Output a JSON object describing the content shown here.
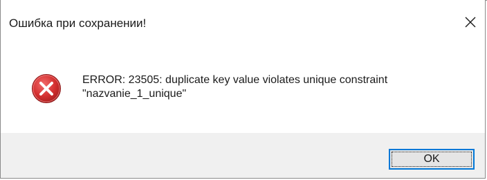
{
  "dialog": {
    "title": "Ошибка при сохранении!",
    "close_icon": "close-icon",
    "icon": "error-icon",
    "message_line1": "ERROR: 23505: duplicate key value violates unique constraint",
    "message_line2": "\"nazvanie_1_unique\"",
    "ok_label": "OK"
  },
  "colors": {
    "error_red": "#d32f2f",
    "focus_blue": "#0078d7",
    "footer_bg": "#f0f0f0"
  }
}
